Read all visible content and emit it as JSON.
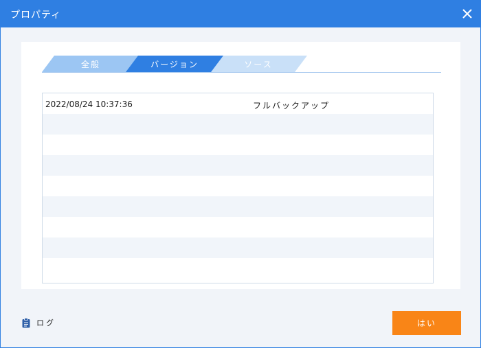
{
  "window": {
    "title": "プロパティ"
  },
  "tabs": [
    {
      "label": "全般",
      "active": false
    },
    {
      "label": "バージョン",
      "active": true
    },
    {
      "label": "ソース",
      "active": false
    }
  ],
  "list": {
    "rows": [
      {
        "date": "2022/08/24 10:37:36",
        "type": "フルバックアップ"
      },
      {
        "date": "",
        "type": ""
      },
      {
        "date": "",
        "type": ""
      },
      {
        "date": "",
        "type": ""
      },
      {
        "date": "",
        "type": ""
      },
      {
        "date": "",
        "type": ""
      },
      {
        "date": "",
        "type": ""
      },
      {
        "date": "",
        "type": ""
      },
      {
        "date": "",
        "type": ""
      }
    ]
  },
  "footer": {
    "log_label": "ログ",
    "yes_label": "はい"
  },
  "colors": {
    "titlebar": "#2f7fe2",
    "tab_active": "#2f7fe2",
    "tab_inactive": "#9cc6f3",
    "primary_button": "#f98517"
  },
  "icons": {
    "close": "close-icon",
    "log": "clipboard-icon"
  }
}
